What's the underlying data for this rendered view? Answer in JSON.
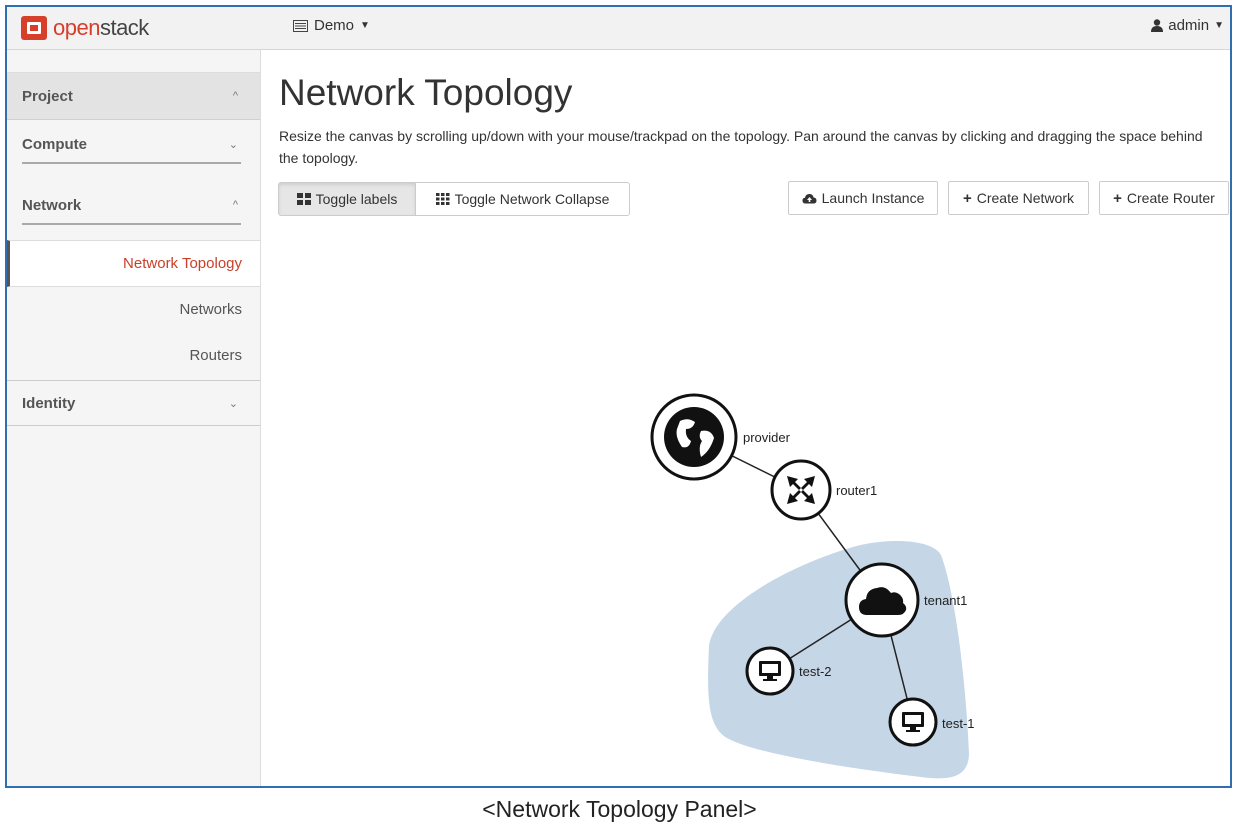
{
  "brand": {
    "prefix": "open",
    "suffix": "stack"
  },
  "header": {
    "project": "Demo",
    "user": "admin"
  },
  "sidebar": {
    "project": "Project",
    "compute": "Compute",
    "network": "Network",
    "items": [
      "Network Topology",
      "Networks",
      "Routers"
    ],
    "identity": "Identity"
  },
  "main": {
    "title": "Network Topology",
    "description": "Resize the canvas by scrolling up/down with your mouse/trackpad on the topology. Pan around the canvas by clicking and dragging the space behind the topology.",
    "buttons": {
      "toggle_labels": "Toggle labels",
      "toggle_collapse": "Toggle Network Collapse",
      "launch_instance": "Launch Instance",
      "create_network": "Create Network",
      "create_router": "Create Router"
    }
  },
  "topology": {
    "nodes": [
      "provider",
      "router1",
      "tenant1",
      "test-2",
      "test-1"
    ]
  },
  "caption": "<Network Topology Panel>",
  "colors": {
    "accent": "#d6402b",
    "network_area": "#c5d6e6",
    "frame": "#2f6fb1"
  }
}
